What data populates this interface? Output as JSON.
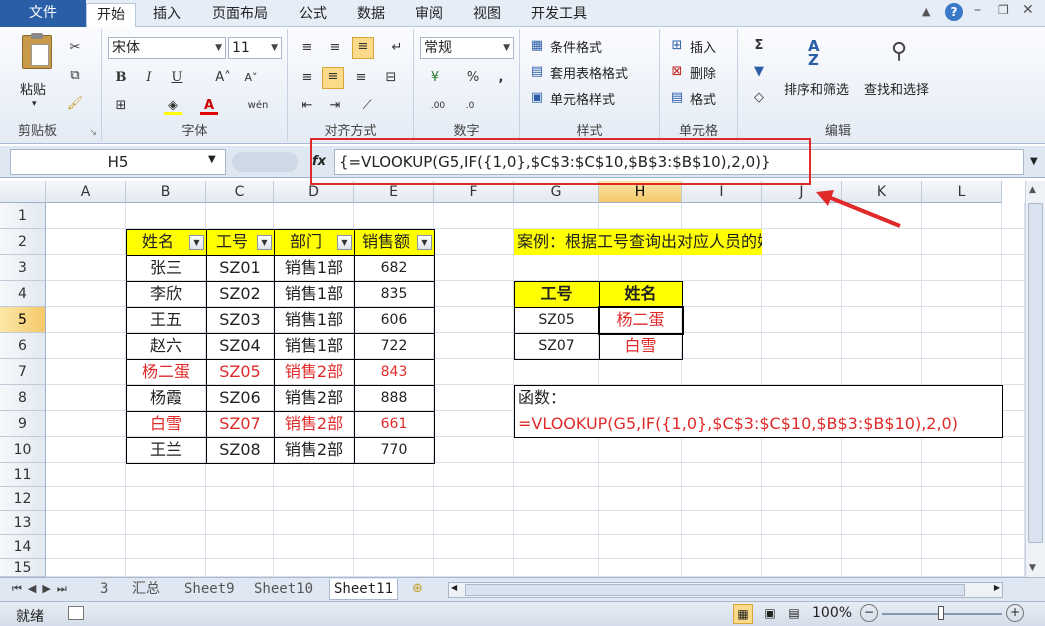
{
  "tabs": [
    "文件",
    "开始",
    "插入",
    "页面布局",
    "公式",
    "数据",
    "审阅",
    "视图",
    "开发工具"
  ],
  "ribbon": {
    "paste": "粘贴",
    "clipboard_label": "剪贴板",
    "font_name": "宋体",
    "font_size": "11",
    "font_label": "字体",
    "align_label": "对齐方式",
    "number_format": "常规",
    "number_label": "数字",
    "cond_format": "条件格式",
    "table_format": "套用表格格式",
    "cell_style": "单元格样式",
    "styles_label": "样式",
    "insert": "插入",
    "delete": "删除",
    "format": "格式",
    "cells_label": "单元格",
    "sort_filter": "排序和筛选",
    "find_select": "查找和选择",
    "editing_label": "编辑"
  },
  "formula_bar": {
    "name_box": "H5",
    "fx": "fx",
    "formula": "{=VLOOKUP(G5,IF({1,0},$C$3:$C$10,$B$3:$B$10),2,0)}"
  },
  "columns": [
    "A",
    "B",
    "C",
    "D",
    "E",
    "F",
    "G",
    "H",
    "I",
    "J",
    "K",
    "L"
  ],
  "rows": [
    "1",
    "2",
    "3",
    "4",
    "5",
    "6",
    "7",
    "8",
    "9",
    "10",
    "11",
    "12",
    "13",
    "14",
    "15"
  ],
  "table": {
    "headers": [
      "姓名",
      "工号",
      "部门",
      "销售额"
    ],
    "rows": [
      [
        "张三",
        "SZ01",
        "销售1部",
        "682"
      ],
      [
        "李欣",
        "SZ02",
        "销售1部",
        "835"
      ],
      [
        "王五",
        "SZ03",
        "销售1部",
        "606"
      ],
      [
        "赵六",
        "SZ04",
        "销售1部",
        "722"
      ],
      [
        "杨二蛋",
        "SZ05",
        "销售2部",
        "843"
      ],
      [
        "杨霞",
        "SZ06",
        "销售2部",
        "888"
      ],
      [
        "白雪",
        "SZ07",
        "销售2部",
        "661"
      ],
      [
        "王兰",
        "SZ08",
        "销售2部",
        "770"
      ]
    ]
  },
  "case_title": "案例：根据工号查询出对应人员的姓名",
  "lookup": {
    "headers": [
      "工号",
      "姓名"
    ],
    "rows": [
      [
        "SZ05",
        "杨二蛋"
      ],
      [
        "SZ07",
        "白雪"
      ]
    ]
  },
  "function_box": {
    "label": "函数：",
    "formula": "=VLOOKUP(G5,IF({1,0},$C$3:$C$10,$B$3:$B$10),2,0)"
  },
  "sheets": [
    "3",
    "汇总",
    "Sheet9",
    "Sheet10",
    "Sheet11"
  ],
  "status": {
    "ready": "就绪",
    "zoom": "100%"
  },
  "colors": {
    "yellow": "#ffff00",
    "red": "#e02a2a",
    "selected": "#f5c96a"
  }
}
